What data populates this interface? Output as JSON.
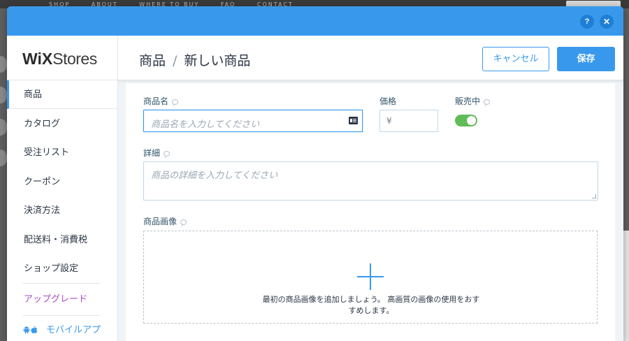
{
  "backdrop": {
    "nav_items": [
      "SHOP",
      "ABOUT",
      "WHERE TO BUY",
      "FAQ",
      "CONTACT"
    ]
  },
  "modal": {
    "help_label": "?",
    "close_label": "✕"
  },
  "header": {
    "logo_wix": "WiX",
    "logo_stores": "Stores",
    "breadcrumb_parent": "商品",
    "breadcrumb_separator": "/",
    "breadcrumb_current": "新しい商品",
    "cancel_label": "キャンセル",
    "save_label": "保存"
  },
  "sidebar": {
    "items": [
      {
        "label": "商品"
      },
      {
        "label": "カタログ"
      },
      {
        "label": "受注リスト"
      },
      {
        "label": "クーポン"
      },
      {
        "label": "決済方法"
      },
      {
        "label": "配送料・消費税"
      },
      {
        "label": "ショップ設定"
      }
    ],
    "upgrade_label": "アップグレード",
    "mobile_label": "モバイルアプ"
  },
  "form": {
    "name_label": "商品名",
    "name_placeholder": "商品名を入力してください",
    "price_label": "価格",
    "currency_symbol": "¥",
    "on_sale_label": "販売中",
    "on_sale_enabled": true,
    "details_label": "詳細",
    "details_placeholder": "商品の詳細を入力してください",
    "images_label": "商品画像",
    "images_hint_line1": "最初の商品画像を追加しましょう。 高画質の画像の使用をおす",
    "images_hint_line2": "すめします。"
  },
  "colors": {
    "accent": "#3899ec",
    "toggle_on": "#60bc57",
    "upgrade": "#aa4dc8"
  }
}
